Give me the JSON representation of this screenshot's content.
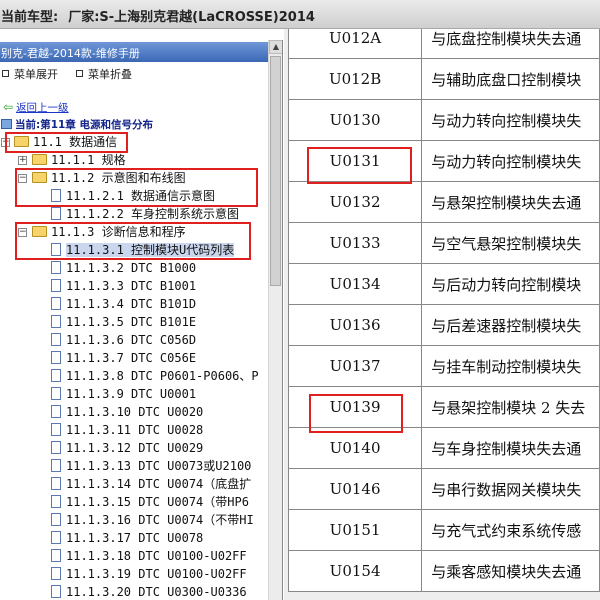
{
  "title_bar": {
    "label": "当前车型:",
    "factory": "厂家:S-上海别克君越(LaCROSSE)2014"
  },
  "sidebar": {
    "header": "别克-君越-2014款-维修手册",
    "expand_menu": "菜单展开",
    "collapse_menu": "菜单折叠",
    "back_link": "返回上一级",
    "current_location": "当前:第11章 电源和信号分布"
  },
  "tree": [
    "11.1 数据通信",
    "11.1.1 规格",
    "11.1.2 示意图和布线图",
    "11.1.2.1 数据通信示意图",
    "11.1.2.2 车身控制系统示意图",
    "11.1.3 诊断信息和程序",
    "11.1.3.1 控制模块U代码列表",
    "11.1.3.2 DTC B1000",
    "11.1.3.3 DTC B1001",
    "11.1.3.4 DTC B101D",
    "11.1.3.5 DTC B101E",
    "11.1.3.6 DTC C056D",
    "11.1.3.7 DTC C056E",
    "11.1.3.8 DTC P0601-P0606、P",
    "11.1.3.9 DTC U0001",
    "11.1.3.10 DTC U0020",
    "11.1.3.11 DTC U0028",
    "11.1.3.12 DTC U0029",
    "11.1.3.13 DTC U0073或U2100",
    "11.1.3.14 DTC U0074（底盘扩",
    "11.1.3.15 DTC U0074（带HP6",
    "11.1.3.16 DTC U0074（不带HI",
    "11.1.3.17 DTC U0078",
    "11.1.3.18 DTC U0100-U02FF",
    "11.1.3.19 DTC U0100-U02FF",
    "11.1.3.20 DTC U0300-U0336"
  ],
  "table_rows": [
    {
      "code": "U012A",
      "desc": "与底盘控制模块失去通"
    },
    {
      "code": "U012B",
      "desc": "与辅助底盘口控制模块"
    },
    {
      "code": "U0130",
      "desc": "与动力转向控制模块失"
    },
    {
      "code": "U0131",
      "desc": "与动力转向控制模块失"
    },
    {
      "code": "U0132",
      "desc": "与悬架控制模块失去通"
    },
    {
      "code": "U0133",
      "desc": "与空气悬架控制模块失"
    },
    {
      "code": "U0134",
      "desc": "与后动力转向控制模块"
    },
    {
      "code": "U0136",
      "desc": "与后差速器控制模块失"
    },
    {
      "code": "U0137",
      "desc": "与挂车制动控制模块失"
    },
    {
      "code": "U0139",
      "desc": "与悬架控制模块 2 失去"
    },
    {
      "code": "U0140",
      "desc": "与车身控制模块失去通"
    },
    {
      "code": "U0146",
      "desc": "与串行数据网关模块失"
    },
    {
      "code": "U0151",
      "desc": "与充气式约束系统传感"
    },
    {
      "code": "U0154",
      "desc": "与乘客感知模块失去通"
    }
  ]
}
